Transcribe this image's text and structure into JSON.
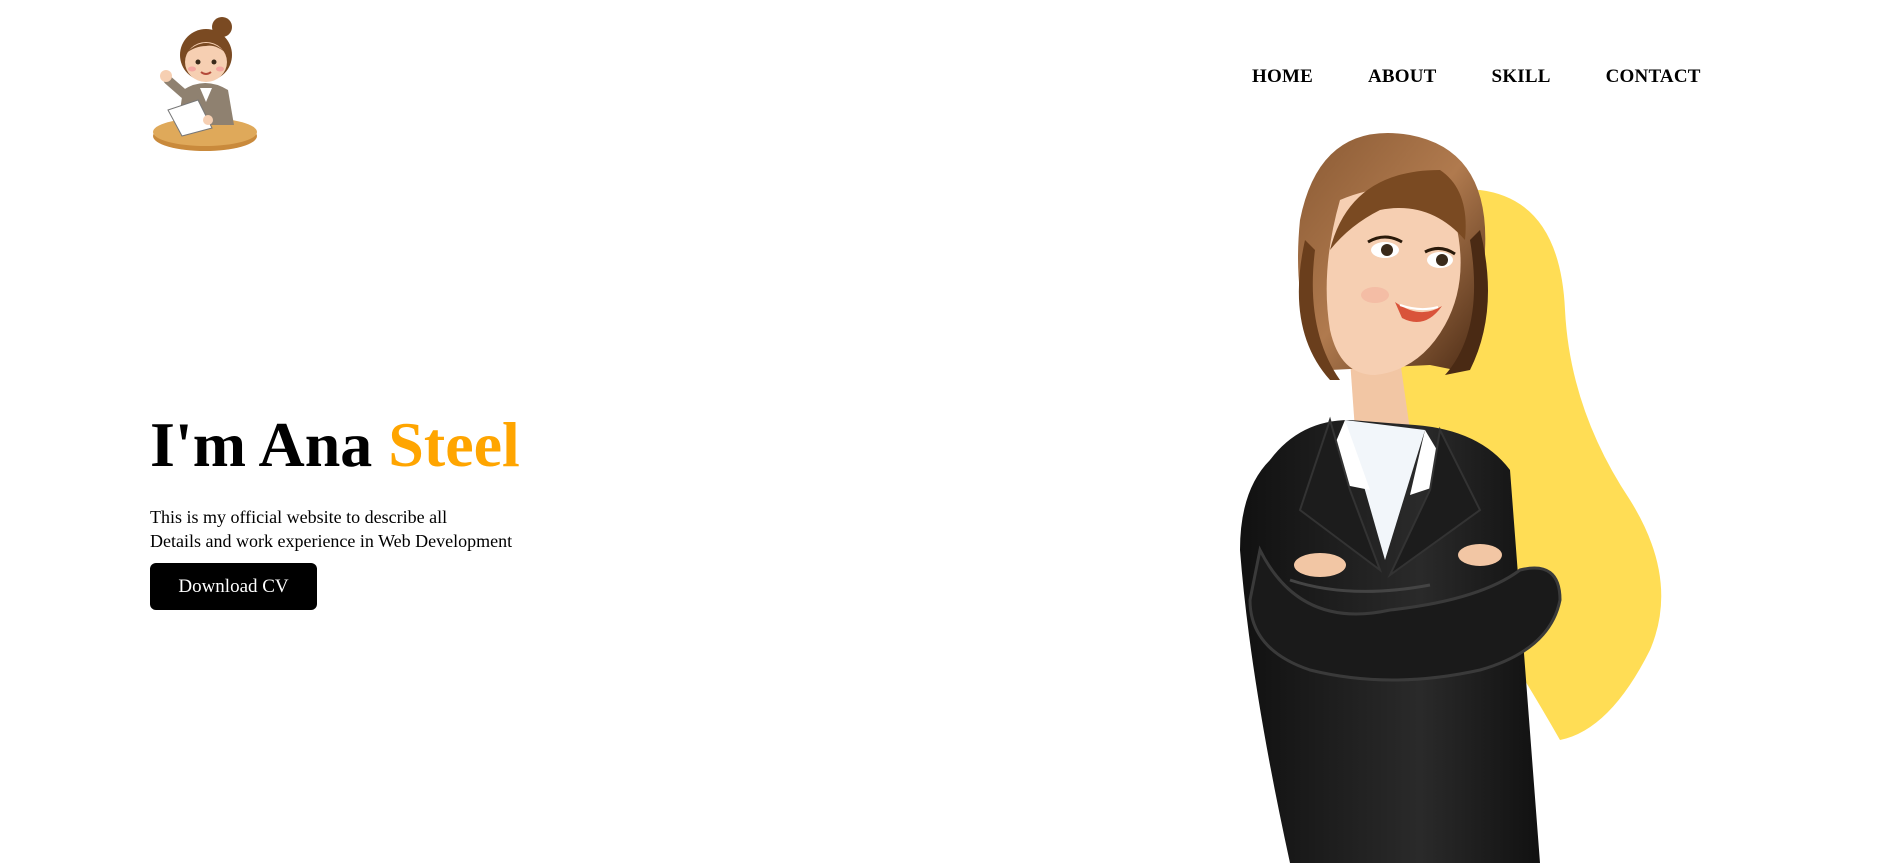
{
  "logo": {
    "icon": "woman-at-desk-waving-logo"
  },
  "nav": {
    "items": [
      {
        "label": "HOME"
      },
      {
        "label": "ABOUT"
      },
      {
        "label": "SKILL"
      },
      {
        "label": "CONTACT"
      }
    ]
  },
  "hero": {
    "title_prefix": "I'm Ana ",
    "title_highlight": "Steel",
    "description_line1": "This is my official website to describe all",
    "description_line2": "Details and work experience in Web Development",
    "button_label": "Download CV"
  },
  "illustration": {
    "icon": "businesswoman-arms-crossed-illustration"
  },
  "colors": {
    "accent": "#ffa500",
    "blob": "#ffdd55",
    "button_bg": "#000000",
    "button_text": "#ffffff"
  }
}
